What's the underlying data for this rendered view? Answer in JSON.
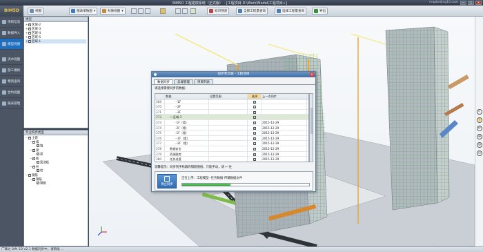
{
  "window": {
    "title": "BIM5D 工程建模系统（正式版） - [工程项目-D:\\Work\\Model\\工程项目+]",
    "url": "mapbeijing10.com",
    "controls": [
      "—",
      "□",
      "✕"
    ]
  },
  "app": {
    "logo": "BIM5D"
  },
  "toolbar": {
    "items": [
      {
        "label": "视图"
      },
      {
        "label": "图表单独图"
      },
      {
        "label": "材质视图"
      },
      {
        "label": "标识预览"
      },
      {
        "label": "全部工程量查询"
      },
      {
        "label": "选择工程量查询"
      },
      {
        "label": "导出"
      }
    ]
  },
  "nav": {
    "items": [
      {
        "label": "项目信息"
      },
      {
        "label": "数据导入"
      },
      {
        "label": "模型视图"
      },
      {
        "label": "流水视图"
      },
      {
        "label": "施工模拟"
      },
      {
        "label": "物资查询"
      },
      {
        "label": "合约视图"
      },
      {
        "label": "报表管理"
      }
    ]
  },
  "panel_top": {
    "title": "楼层",
    "items": [
      "区域-2",
      "区域-3",
      "区域-4",
      "区域-5",
      "区域-1"
    ]
  },
  "panel_bottom": {
    "title": "专业构件类型",
    "items": [
      {
        "label": "土建",
        "level": 0,
        "exp": "−"
      },
      {
        "label": "墙",
        "level": 1,
        "exp": "−"
      },
      {
        "label": "墙",
        "level": 2,
        "exp": ""
      },
      {
        "label": "梁",
        "level": 1,
        "exp": "−"
      },
      {
        "label": "梁",
        "level": 2,
        "exp": ""
      },
      {
        "label": "板",
        "level": 1,
        "exp": "−"
      },
      {
        "label": "现浇板",
        "level": 2,
        "exp": ""
      },
      {
        "label": "柱",
        "level": 1,
        "exp": "−"
      },
      {
        "label": "柱",
        "level": 2,
        "exp": ""
      },
      {
        "label": "钢筋",
        "level": 0,
        "exp": "−"
      },
      {
        "label": "钢筋",
        "level": 1,
        "exp": "−"
      },
      {
        "label": "钢筋",
        "level": 2,
        "exp": ""
      }
    ]
  },
  "right_tools": [
    "↖",
    "✋",
    "⟳",
    "⊕",
    "⊖",
    "⊙"
  ],
  "status": {
    "text": "广联达 BIM 5D V2.1 数据同步中，请稍候 ..."
  },
  "dialog": {
    "title": "同步至云端 - 工程项目",
    "tabs": [
      "数据同步",
      "云端管理",
      "项目列表"
    ],
    "hint": "请选择需要同步的数据：",
    "columns": [
      "",
      "数据",
      "设置范围",
      "选择",
      "上一次同步"
    ],
    "rows": [
      {
        "id": "369",
        "name": "-1F",
        "indent": 2,
        "checked": true,
        "date": ""
      },
      {
        "id": "370",
        "name": "-2F",
        "indent": 2,
        "checked": true,
        "date": ""
      },
      {
        "id": "371",
        "name": "-3F",
        "indent": 2,
        "checked": true,
        "date": ""
      },
      {
        "id": "372",
        "name": "区域-1",
        "indent": 1,
        "checked": true,
        "date": "",
        "highlight": true
      },
      {
        "id": "373",
        "name": "1F（墙）",
        "indent": 2,
        "checked": true,
        "date": "2015-12-29"
      },
      {
        "id": "374",
        "name": "2F（墙）",
        "indent": 2,
        "checked": true,
        "date": "2015-12-29"
      },
      {
        "id": "375",
        "name": "1F（墙）",
        "indent": 2,
        "checked": true,
        "date": "2015-12-29"
      },
      {
        "id": "376",
        "name": "-1F（墙）",
        "indent": 2,
        "checked": true,
        "date": "2015-12-29"
      },
      {
        "id": "377",
        "name": "-2F（墙）",
        "indent": 2,
        "checked": true,
        "date": "2015-12-29"
      },
      {
        "id": "378",
        "name": "数据安全",
        "indent": 1,
        "checked": true,
        "date": "2015-12-29"
      },
      {
        "id": "379",
        "name": "资源跟踪",
        "indent": 1,
        "checked": true,
        "date": "2015-12-29"
      },
      {
        "id": "380",
        "name": "任务进度",
        "indent": 1,
        "checked": true,
        "date": "2015-12-29"
      },
      {
        "id": "381",
        "name": "成本分析",
        "indent": 1,
        "checked": true,
        "date": "2015-12-29"
      }
    ],
    "warning": "温馨提示：同步到手机端的钢筋图纸，只能手动，请 ← 往",
    "stop_label": "停止同步",
    "progress_text": "正在上传：工程模型--任务数据-传输数据文件",
    "progress": 0.38
  },
  "colors": {
    "accent": "#1e6fc0",
    "progress": "#2da52d",
    "dialog_title": "#3f6da3",
    "select_header": "#f4d79a"
  }
}
